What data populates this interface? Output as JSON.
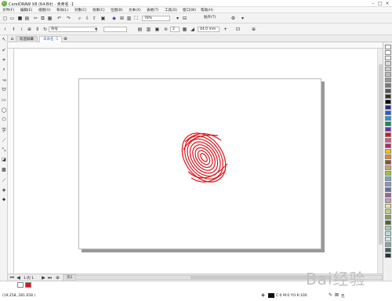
{
  "window": {
    "title": "CorelDRAW X8 (64-Bit) - 未命名 -1",
    "logo": "Ⓒ"
  },
  "menu": [
    "文件(F)",
    "编辑(E)",
    "视图(V)",
    "布局(L)",
    "对象(C)",
    "效果(C)",
    "位图(B)",
    "文本(X)",
    "表格(T)",
    "工具(O)",
    "窗口(W)",
    "帮助(H)"
  ],
  "toolbar": {
    "zoom": "78%",
    "snap": "贴齐(T)"
  },
  "propbar": {
    "font_dropdown": "符号",
    "size_value": "2",
    "outline_value": "44.0 mm"
  },
  "tabs": {
    "welcome": "欢迎屏幕",
    "doc": "未命名 -1"
  },
  "pagebar": {
    "page_counter": "1 的 1",
    "page_tab": "页1"
  },
  "status": {
    "coords": "(19.258, 281.658 )",
    "fill_info": "C:0 M:0 Y:0 K:100",
    "outline_info": "无"
  },
  "watermark": "Bai经验",
  "colors": {
    "accent": "#2a6ad0",
    "fingerprint": "#e0141b"
  }
}
